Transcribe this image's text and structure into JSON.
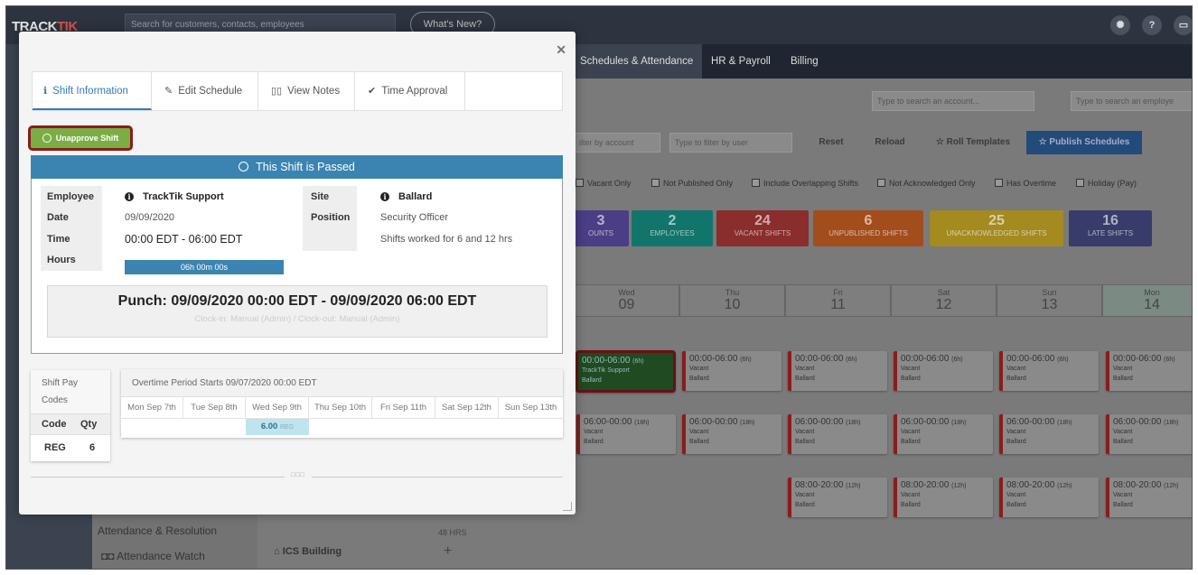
{
  "app": {
    "logo_main": "TRACK",
    "logo_accent": "TIK",
    "search_placeholder": "Search for customers, contacts, employees",
    "whats_new": "What's New?",
    "help_icon": "?",
    "nav": [
      "Schedules & Attendance",
      "HR & Payroll",
      "Billing"
    ],
    "account_search": "Type to search an account...",
    "employee_search": "Type to search an employe",
    "filter_account": "ilter by account",
    "filter_user": "Type to filter by user",
    "buttons": [
      "Reset",
      "Reload",
      "Roll Templates",
      "Publish Schedules"
    ],
    "checkboxes": [
      "Vacant Only",
      "Not Published Only",
      "Include Overlapping Shifts",
      "Not Acknowledged Only",
      "Has Overtime",
      "Holiday (Pay)"
    ],
    "stats": [
      {
        "num": "3",
        "label": "OUNTS",
        "color": "#4b3e86"
      },
      {
        "num": "2",
        "label": "EMPLOYEES",
        "color": "#11756b"
      },
      {
        "num": "24",
        "label": "VACANT SHIFTS",
        "color": "#8a2d2d"
      },
      {
        "num": "6",
        "label": "UNPUBLISHED SHIFTS",
        "color": "#a34d1c"
      },
      {
        "num": "25",
        "label": "UNACKNOWLEDGED SHIFTS",
        "color": "#a48a1f"
      },
      {
        "num": "16",
        "label": "LATE SHIFTS",
        "color": "#383c6a"
      }
    ],
    "days": [
      {
        "dow": "Wed",
        "num": "09"
      },
      {
        "dow": "Thu",
        "num": "10"
      },
      {
        "dow": "Fri",
        "num": "11"
      },
      {
        "dow": "Sat",
        "num": "12"
      },
      {
        "dow": "Sun",
        "num": "13"
      },
      {
        "dow": "Mon",
        "num": "14"
      }
    ],
    "selected_shift": {
      "time": "00:00-06:00",
      "dur": "(6h)",
      "who": "TrackTik Support",
      "site": "Ballard"
    },
    "row1": {
      "time": "00:00-06:00",
      "dur": "(6h)",
      "who": "Vacant",
      "site": "Ballard"
    },
    "row2": {
      "time": "06:00-00:00",
      "dur": "(18h)",
      "who": "Vacant",
      "site": "Ballard"
    },
    "row3": {
      "time": "08:00-20:00",
      "dur": "(12h)",
      "who": "Vacant",
      "site": "Ballard"
    },
    "left_items": [
      "Attendance & Resolution",
      "Attendance Watch"
    ],
    "hrs_label": "48 HRS",
    "building": "ICS Building"
  },
  "modal": {
    "tabs": [
      {
        "label": "Shift Information",
        "icon": "info-icon"
      },
      {
        "label": "Edit Schedule",
        "icon": "pencil-icon"
      },
      {
        "label": "View Notes",
        "icon": "book-icon"
      },
      {
        "label": "Time Approval",
        "icon": "check-icon"
      }
    ],
    "unapprove_label": "Unapprove Shift",
    "status_banner": "This Shift is Passed",
    "fields": {
      "employee_label": "Employee",
      "employee_value": "TrackTik Support",
      "date_label": "Date",
      "date_value": "09/09/2020",
      "time_label": "Time",
      "time_value": "00:00 EDT - 06:00 EDT",
      "hours_label": "Hours",
      "hours_value": "06h 00m 00s",
      "site_label": "Site",
      "site_value": "Ballard",
      "position_label": "Position",
      "position_value": "Security Officer",
      "rule_text": "Shifts worked for 6 and 12 hrs"
    },
    "punch": {
      "title": "Punch: 09/09/2020 00:00 EDT - 09/09/2020 06:00 EDT",
      "sub": "Clock-in: Manual (Admin)   /   Clock-out: Manual (Admin)"
    },
    "pay_codes": {
      "title": "Shift Pay Codes",
      "code_header": "Code",
      "qty_header": "Qty",
      "code": "REG",
      "qty": "6"
    },
    "overtime": {
      "title": "Overtime Period Starts 09/07/2020 00:00 EDT",
      "days": [
        "Mon Sep 7th",
        "Tue Sep 8th",
        "Wed Sep 9th",
        "Thu Sep 10th",
        "Fri Sep 11th",
        "Sat Sep 12th",
        "Sun Sep 13th"
      ],
      "value": "6.00",
      "value_code": "REG"
    },
    "grip": "□□□"
  }
}
